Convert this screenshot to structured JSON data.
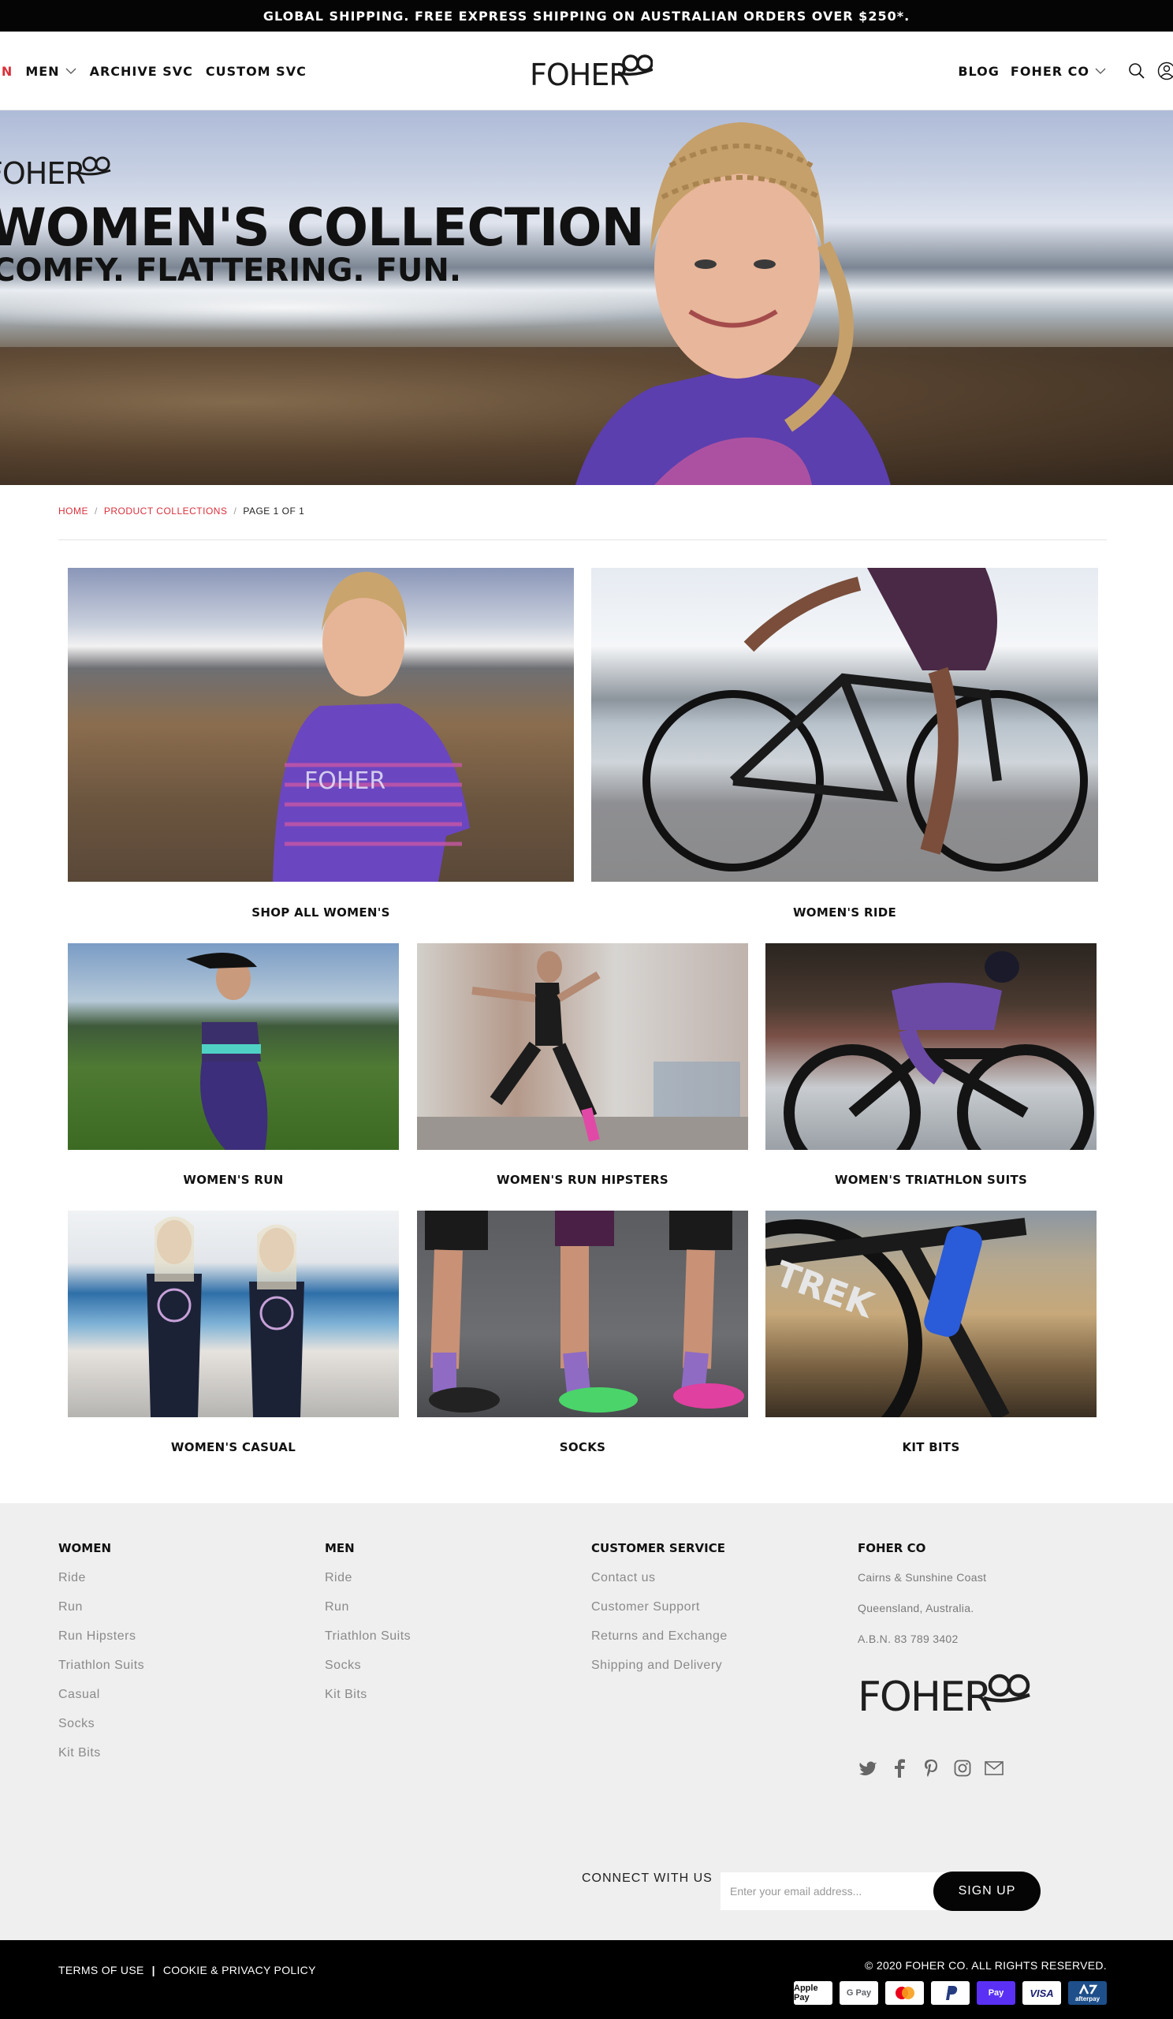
{
  "announcement": "GLOBAL SHIPPING. FREE EXPRESS SHIPPING ON AUSTRALIAN ORDERS OVER $250*.",
  "nav": {
    "left": [
      {
        "label": "EN",
        "has_dropdown": false
      },
      {
        "label": "MEN",
        "has_dropdown": true
      },
      {
        "label": "ARCHIVE SVC",
        "has_dropdown": false
      },
      {
        "label": "CUSTOM SVC",
        "has_dropdown": false
      }
    ],
    "right": [
      {
        "label": "BLOG",
        "has_dropdown": false
      },
      {
        "label": "FOHER CO",
        "has_dropdown": true
      }
    ],
    "icons": [
      "search-icon",
      "account-icon"
    ],
    "logo_text": "FOHER CO"
  },
  "hero": {
    "brand": "FOHER CO",
    "title": "WOMEN'S COLLECTION",
    "subtitle": "COMFY. FLATTERING. FUN."
  },
  "breadcrumb": {
    "home": "HOME",
    "collections": "PRODUCT COLLECTIONS",
    "current": "PAGE 1 OF 1",
    "separator": "/"
  },
  "collections": [
    {
      "label": "SHOP ALL WOMEN'S",
      "image": "woman-purple-jersey-beach"
    },
    {
      "label": "WOMEN'S RIDE",
      "image": "cyclist-road-bike-waterfront"
    },
    {
      "label": "WOMEN'S RUN",
      "image": "runner-grass-field"
    },
    {
      "label": "WOMEN'S RUN HIPSTERS",
      "image": "runner-brick-wall"
    },
    {
      "label": "WOMEN'S TRIATHLON SUITS",
      "image": "triathlete-tt-bike"
    },
    {
      "label": "WOMEN'S CASUAL",
      "image": "two-women-beach-tanks"
    },
    {
      "label": "SOCKS",
      "image": "legs-cycling-socks"
    },
    {
      "label": "KIT BITS",
      "image": "bike-bottle-closeup"
    }
  ],
  "footer": {
    "columns": [
      {
        "heading": "WOMEN",
        "links": [
          "Ride",
          "Run",
          "Run Hipsters",
          "Triathlon Suits",
          "Casual",
          "Socks",
          "Kit Bits"
        ]
      },
      {
        "heading": "MEN",
        "links": [
          "Ride",
          "Run",
          "Triathlon Suits",
          "Socks",
          "Kit Bits"
        ]
      },
      {
        "heading": "CUSTOMER SERVICE",
        "links": [
          "Contact us",
          "Customer Support",
          "Returns and Exchange",
          "Shipping and Delivery"
        ]
      }
    ],
    "company": {
      "heading": "FOHER CO",
      "lines": [
        "Cairns & Sunshine Coast",
        "Queensland, Australia.",
        "A.B.N. 83 789 3402"
      ],
      "logo_text": "FOHER CO"
    },
    "social": [
      "twitter-icon",
      "facebook-icon",
      "pinterest-icon",
      "instagram-icon",
      "mail-icon"
    ],
    "connect_label": "CONNECT WITH US",
    "email_placeholder": "Enter your email address...",
    "signup_label": "SIGN UP"
  },
  "bottom": {
    "terms": "TERMS OF USE",
    "divider": "|",
    "privacy": "COOKIE & PRIVACY POLICY",
    "copyright": "© 2020 FOHER CO. ALL RIGHTS RESERVED.",
    "payments": [
      "Apple Pay",
      "G Pay",
      "mastercard",
      "PayPal",
      "Pay",
      "VISA",
      "afterpay"
    ]
  },
  "colors": {
    "accent": "#d9303b",
    "dark": "#050505",
    "footer_bg": "#efefef"
  }
}
